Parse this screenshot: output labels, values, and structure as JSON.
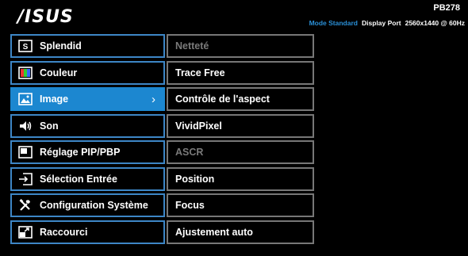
{
  "header": {
    "logo": "/ISUS",
    "model": "PB278",
    "mode": "Mode Standard",
    "port": "Display Port",
    "resolution": "2560x1440 @ 60Hz"
  },
  "menu": {
    "items": [
      {
        "label": "Splendid",
        "icon": "splendid-s-icon"
      },
      {
        "label": "Couleur",
        "icon": "color-icon"
      },
      {
        "label": "Image",
        "icon": "image-icon",
        "active": true
      },
      {
        "label": "Son",
        "icon": "speaker-icon"
      },
      {
        "label": "Réglage PIP/PBP",
        "icon": "pip-icon"
      },
      {
        "label": "Sélection Entrée",
        "icon": "input-icon"
      },
      {
        "label": "Configuration Système",
        "icon": "tools-icon"
      },
      {
        "label": "Raccourci",
        "icon": "shortcut-icon"
      }
    ],
    "arrow": "›"
  },
  "submenu": {
    "items": [
      {
        "label": "Netteté",
        "enabled": false
      },
      {
        "label": "Trace Free",
        "enabled": true
      },
      {
        "label": "Contrôle de l'aspect",
        "enabled": true
      },
      {
        "label": "VividPixel",
        "enabled": true
      },
      {
        "label": "ASCR",
        "enabled": false
      },
      {
        "label": "Position",
        "enabled": true
      },
      {
        "label": "Focus",
        "enabled": true
      },
      {
        "label": "Ajustement auto",
        "enabled": true
      }
    ]
  },
  "colors": {
    "accent": "#1c87d0",
    "border": "#3d86c6",
    "mode_text": "#2a8fd6",
    "disabled_text": "#7a7a7a"
  }
}
